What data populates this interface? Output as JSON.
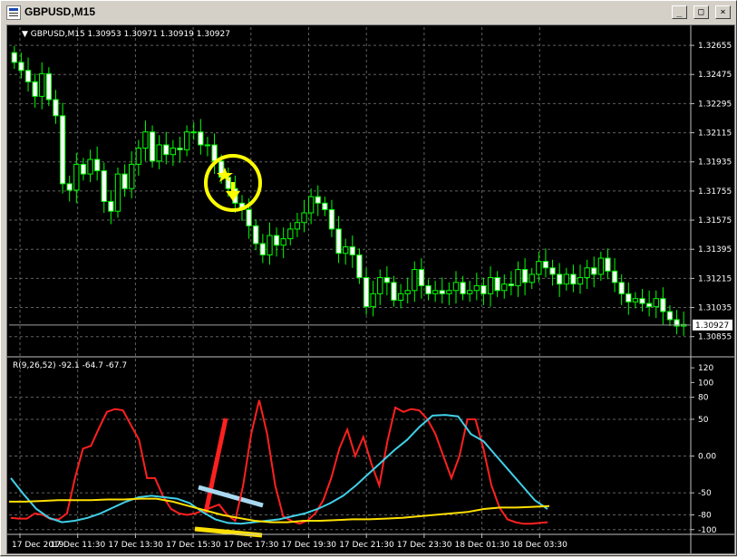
{
  "window": {
    "title": "GBPUSD,M15",
    "min_label": "_",
    "max_label": "□",
    "close_label": "×"
  },
  "chart_data": [
    {
      "type": "candlestick",
      "title": "GBPUSD,M15  1.30953 1.30971 1.30919 1.30927",
      "ylim": [
        1.30775,
        1.32745
      ],
      "yticks": [
        "1.32655",
        "1.32475",
        "1.32295",
        "1.32115",
        "1.31935",
        "1.31755",
        "1.31575",
        "1.31395",
        "1.31215",
        "1.31035",
        "1.30855"
      ],
      "current_price": "1.30927",
      "grid": true,
      "colors": {
        "background": "#000000",
        "candle": "#00ff00",
        "grid": "#606060",
        "annotation": "#ffff00"
      },
      "close": [
        1.3255,
        1.325,
        1.3243,
        1.3234,
        1.3248,
        1.3232,
        1.3222,
        1.318,
        1.3176,
        1.3192,
        1.3186,
        1.3195,
        1.3188,
        1.3169,
        1.3163,
        1.3186,
        1.3177,
        1.3192,
        1.3202,
        1.3212,
        1.3194,
        1.3204,
        1.3198,
        1.3202,
        1.3201,
        1.3212,
        1.3212,
        1.3204,
        1.3204,
        1.3194,
        1.3184,
        1.3177,
        1.3168,
        1.3164,
        1.3154,
        1.3143,
        1.3136,
        1.3148,
        1.3142,
        1.3146,
        1.3152,
        1.3156,
        1.3162,
        1.3172,
        1.3168,
        1.3164,
        1.3152,
        1.3137,
        1.3141,
        1.3136,
        1.3122,
        1.3104,
        1.3112,
        1.3122,
        1.3119,
        1.3108,
        1.3112,
        1.3114,
        1.3127,
        1.3117,
        1.3112,
        1.3114,
        1.3112,
        1.3114,
        1.3119,
        1.3112,
        1.3114,
        1.3117,
        1.3112,
        1.3122,
        1.3114,
        1.3118,
        1.3117,
        1.3127,
        1.3119,
        1.3124,
        1.3132,
        1.3128,
        1.3124,
        1.3118,
        1.3124,
        1.3118,
        1.3122,
        1.3128,
        1.3124,
        1.3134,
        1.3126,
        1.3119,
        1.3112,
        1.3107,
        1.3109,
        1.3106,
        1.3104,
        1.3109,
        1.3101,
        1.3096,
        1.3092,
        1.3093
      ],
      "indicator": {
        "label": "R(9,26,52) -92.1 -64.7 -67.7",
        "ylim": [
          -104,
          130
        ],
        "yticks": [
          "120",
          "100",
          "80",
          "50",
          "0.00",
          "-50",
          "-80",
          "-100"
        ],
        "series": [
          {
            "color": "#ff2020",
            "values": [
              -84,
              -85,
              -85,
              -78,
              -80,
              -86,
              -86,
              -78,
              -30,
              10,
              14,
              38,
              60,
              64,
              62,
              42,
              22,
              -30,
              -30,
              -55,
              -72,
              -78,
              -80,
              -78,
              -74,
              -70,
              -66,
              -80,
              -88,
              -40,
              30,
              76,
              30,
              -40,
              -82,
              -88,
              -92,
              -88,
              -78,
              -60,
              -30,
              10,
              36,
              0,
              26,
              -10,
              -40,
              20,
              66,
              60,
              64,
              62,
              50,
              30,
              0,
              -30,
              0,
              50,
              50,
              10,
              -40,
              -70,
              -86,
              -90,
              -92,
              -92,
              -91,
              -90
            ]
          },
          {
            "color": "#40d0e8",
            "values": [
              -30,
              -52,
              -72,
              -84,
              -90,
              -88,
              -84,
              -78,
              -70,
              -62,
              -56,
              -54,
              -56,
              -58,
              -64,
              -76,
              -86,
              -91,
              -92,
              -90,
              -88,
              -86,
              -82,
              -78,
              -72,
              -64,
              -54,
              -40,
              -24,
              -8,
              8,
              22,
              40,
              55,
              56,
              54,
              30,
              20,
              0,
              -20,
              -40,
              -60,
              -72
            ]
          },
          {
            "color": "#ffe000",
            "values": [
              -62,
              -62,
              -61,
              -60,
              -60,
              -60,
              -59,
              -59,
              -58,
              -58,
              -62,
              -68,
              -74,
              -80,
              -84,
              -88,
              -90,
              -90,
              -88,
              -88,
              -87,
              -86,
              -86,
              -85,
              -84,
              -82,
              -80,
              -78,
              -76,
              -72,
              -70,
              -70,
              -69,
              -68
            ]
          }
        ]
      },
      "x_labels": [
        "17 Dec 2019",
        "17 Dec 11:30",
        "17 Dec 13:30",
        "17 Dec 15:30",
        "17 Dec 17:30",
        "17 Dec 19:30",
        "17 Dec 21:30",
        "17 Dec 23:30",
        "18 Dec 01:30",
        "18 Dec 03:30"
      ]
    }
  ]
}
